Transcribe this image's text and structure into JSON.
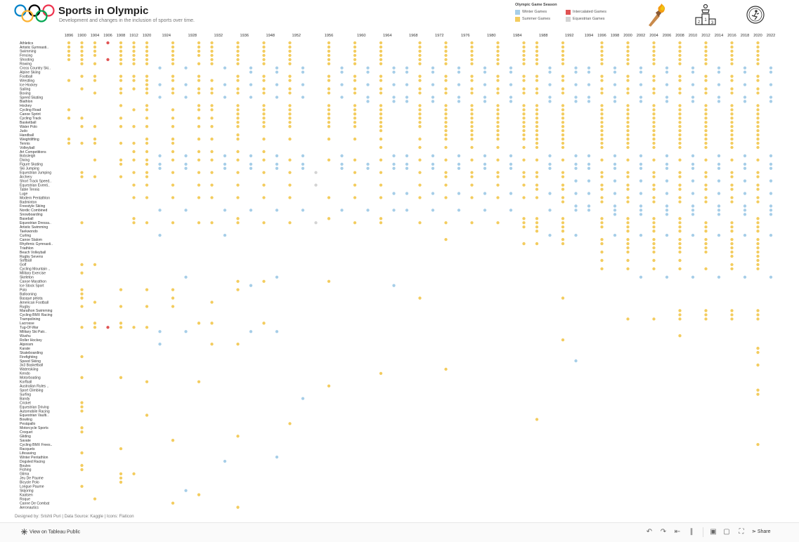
{
  "header": {
    "title": "Sports in Olympic",
    "subtitle": "Development and changes in the inclusion of sports over time."
  },
  "legend": {
    "title": "Olympic Game Season",
    "items": [
      {
        "label": "Winter Games",
        "color": "#a6cee8"
      },
      {
        "label": "Summer Games",
        "color": "#f3cc5e"
      },
      {
        "label": "Intercalated Games",
        "color": "#e05353"
      },
      {
        "label": "Equestrian Games",
        "color": "#d3d3d3"
      }
    ]
  },
  "icons": [
    "olympic-rings-icon",
    "olympic-torch-icon",
    "podium-icon",
    "medal-icon"
  ],
  "credits": "Designed by: Srishti Puri | Data Source: Kaggle | Icons: Flaticon",
  "footer": {
    "view_label": "View on Tableau Public",
    "share_label": "Share"
  },
  "chart_data": {
    "type": "scatter",
    "x_axis_position": "top",
    "columns": [
      {
        "year": "1896",
        "season": "Summer"
      },
      {
        "year": "1900",
        "season": "Summer"
      },
      {
        "year": "1904",
        "season": "Summer"
      },
      {
        "year": "1906",
        "season": "Intercalated"
      },
      {
        "year": "1908",
        "season": "Summer"
      },
      {
        "year": "1912",
        "season": "Summer"
      },
      {
        "year": "1920",
        "season": "Summer"
      },
      {
        "year": "1924",
        "season": "Winter"
      },
      {
        "year": "1924",
        "season": "Summer"
      },
      {
        "year": "1928",
        "season": "Winter"
      },
      {
        "year": "1928",
        "season": "Summer"
      },
      {
        "year": "1932",
        "season": "Summer"
      },
      {
        "year": "1932",
        "season": "Winter"
      },
      {
        "year": "1936",
        "season": "Summer"
      },
      {
        "year": "1936",
        "season": "Winter"
      },
      {
        "year": "1948",
        "season": "Summer"
      },
      {
        "year": "1948",
        "season": "Winter"
      },
      {
        "year": "1952",
        "season": "Summer"
      },
      {
        "year": "1952",
        "season": "Winter"
      },
      {
        "year": "1956",
        "season": "Equestrian"
      },
      {
        "year": "1956",
        "season": "Summer"
      },
      {
        "year": "1956",
        "season": "Winter"
      },
      {
        "year": "1960",
        "season": "Summer"
      },
      {
        "year": "1960",
        "season": "Winter"
      },
      {
        "year": "1964",
        "season": "Summer"
      },
      {
        "year": "1964",
        "season": "Winter"
      },
      {
        "year": "1968",
        "season": "Winter"
      },
      {
        "year": "1968",
        "season": "Summer"
      },
      {
        "year": "1972",
        "season": "Winter"
      },
      {
        "year": "1972",
        "season": "Summer"
      },
      {
        "year": "1976",
        "season": "Winter"
      },
      {
        "year": "1976",
        "season": "Summer"
      },
      {
        "year": "1980",
        "season": "Winter"
      },
      {
        "year": "1980",
        "season": "Summer"
      },
      {
        "year": "1984",
        "season": "Winter"
      },
      {
        "year": "1984",
        "season": "Summer"
      },
      {
        "year": "1988",
        "season": "Summer"
      },
      {
        "year": "1988",
        "season": "Winter"
      },
      {
        "year": "1992",
        "season": "Summer"
      },
      {
        "year": "1992",
        "season": "Winter"
      },
      {
        "year": "1994",
        "season": "Winter"
      },
      {
        "year": "1996",
        "season": "Summer"
      },
      {
        "year": "1998",
        "season": "Winter"
      },
      {
        "year": "2000",
        "season": "Summer"
      },
      {
        "year": "2002",
        "season": "Winter"
      },
      {
        "year": "2004",
        "season": "Summer"
      },
      {
        "year": "2006",
        "season": "Winter"
      },
      {
        "year": "2008",
        "season": "Summer"
      },
      {
        "year": "2010",
        "season": "Winter"
      },
      {
        "year": "2012",
        "season": "Summer"
      },
      {
        "year": "2014",
        "season": "Winter"
      },
      {
        "year": "2016",
        "season": "Summer"
      },
      {
        "year": "2018",
        "season": "Winter"
      },
      {
        "year": "2020",
        "season": "Summer"
      },
      {
        "year": "2022",
        "season": "Winter"
      }
    ],
    "sports": [
      {
        "name": "Athletics",
        "years": "1896 1900 1904 1906I 1908 1912 1920 1924 1928 1932 1936 1948 1952 1956 1960 1964 1968 1972 1976 1980 1984 1988 1992 1996 2000 2004 2008 2012 2016 2020"
      },
      {
        "name": "Artistic Gymnastics",
        "years": "1896 1900 1904 1908 1912 1920 1924 1928 1932 1936 1948 1952 1956 1960 1964 1968 1972 1976 1980 1984 1988 1992 1996 2000 2004 2008 2012 2016 2020"
      },
      {
        "name": "Swimming",
        "years": "1896 1900 1904 1908 1912 1920 1924 1928 1932 1936 1948 1952 1956 1960 1964 1968 1972 1976 1980 1984 1988 1992 1996 2000 2004 2008 2012 2016 2020"
      },
      {
        "name": "Fencing",
        "years": "1896 1900 1904 1908 1912 1920 1924 1928 1932 1936 1948 1952 1956 1960 1964 1968 1972 1976 1980 1984 1988 1992 1996 2000 2004 2008 2012 2016 2020"
      },
      {
        "name": "Shooting",
        "years": "1896 1900 1906I 1908 1912 1920 1924 1932 1936 1948 1952 1956 1960 1964 1968 1972 1976 1980 1984 1988 1992 1996 2000 2004 2008 2012 2016 2020"
      },
      {
        "name": "Rowing",
        "years": "1900 1904 1908 1912 1920 1924 1928 1932 1936 1948 1952 1956 1960 1964 1968 1972 1976 1980 1984 1988 1992 1996 2000 2004 2008 2012 2016 2020"
      },
      {
        "name": "Cross Country Skiing",
        "years": "1924W 1928W 1932W 1936W 1948W 1952W 1956W 1960W 1964W 1968W 1972W 1976W 1980W 1984W 1988W 1992W 1994W 1998W 2002W 2006W 2010W 2014W 2018W 2022W"
      },
      {
        "name": "Alpine Skiing",
        "years": "1936W 1948W 1952W 1956W 1960W 1964W 1968W 1972W 1976W 1980W 1984W 1988W 1992W 1994W 1998W 2002W 2006W 2010W 2014W 2018W 2022W"
      },
      {
        "name": "Football",
        "years": "1900 1904 1908 1912 1920 1924 1928 1936 1948 1952 1956 1960 1964 1968 1972 1976 1980 1984 1988 1992 1996 2000 2004 2008 2012 2016 2020"
      },
      {
        "name": "Wrestling",
        "years": "1896 1904 1908 1912 1920 1924 1928 1932 1936 1948 1952 1956 1960 1964 1968 1972 1976 1980 1984 1988 1992 1996 2000 2004 2008 2012 2016 2020"
      },
      {
        "name": "Ice Hockey",
        "years": "1920 1924W 1928W 1932W 1936W 1948W 1952W 1956W 1960W 1964W 1968W 1972W 1976W 1980W 1984W 1988W 1992W 1994W 1998W 2002W 2006W 2010W 2014W 2018W 2022W"
      },
      {
        "name": "Sailing",
        "years": "1900 1908 1912 1920 1924 1928 1932 1936 1948 1952 1956 1960 1964 1968 1972 1976 1980 1984 1988 1992 1996 2000 2004 2008 2012 2016 2020"
      },
      {
        "name": "Boxing",
        "years": "1904 1908 1920 1924 1928 1932 1936 1948 1952 1956 1960 1964 1968 1972 1976 1980 1984 1988 1992 1996 2000 2004 2008 2012 2016 2020"
      },
      {
        "name": "Speed Skating",
        "years": "1924W 1928W 1932W 1936W 1948W 1952W 1956W 1960W 1964W 1968W 1972W 1976W 1980W 1984W 1988W 1992W 1994W 1998W 2002W 2006W 2010W 2014W 2018W 2022W"
      },
      {
        "name": "Biathlon",
        "years": "1960W 1964W 1968W 1972W 1976W 1980W 1984W 1988W 1992W 1994W 1998W 2002W 2006W 2010W 2014W 2018W 2022W"
      },
      {
        "name": "Hockey",
        "years": "1908 1920 1928 1932 1936 1948 1952 1956 1960 1964 1968 1972 1976 1980 1984 1988 1992 1996 2000 2004 2008 2012 2016 2020"
      },
      {
        "name": "Cycling Road",
        "years": "1896 1912 1920 1924 1928 1932 1936 1948 1952 1956 1960 1964 1968 1972 1976 1980 1984 1988 1992 1996 2000 2004 2008 2012 2016 2020"
      },
      {
        "name": "Canoe Sprint",
        "years": "1936 1948 1952 1956 1960 1964 1968 1972 1976 1980 1984 1988 1992 1996 2000 2004 2008 2012 2016 2020"
      },
      {
        "name": "Cycling Track",
        "years": "1896 1900 1908 1920 1924 1928 1932 1936 1948 1952 1956 1960 1964 1968 1972 1976 1980 1984 1988 1992 1996 2000 2004 2008 2012 2016 2020"
      },
      {
        "name": "Basketball",
        "years": "1936 1948 1952 1956 1960 1964 1968 1972 1976 1980 1984 1988 1992 1996 2000 2004 2008 2012 2016 2020"
      },
      {
        "name": "Water Polo",
        "years": "1900 1904 1908 1912 1920 1924 1928 1932 1936 1948 1952 1956 1960 1964 1968 1972 1976 1980 1984 1988 1992 1996 2000 2004 2008 2012 2016 2020"
      },
      {
        "name": "Judo",
        "years": "1964 1972 1976 1980 1984 1988 1992 1996 2000 2004 2008 2012 2016 2020"
      },
      {
        "name": "Handball",
        "years": "1936 1972 1976 1980 1984 1988 1992 1996 2000 2004 2008 2012 2016 2020"
      },
      {
        "name": "Weightlifting",
        "years": "1896 1904 1920 1924 1928 1932 1936 1948 1952 1956 1960 1964 1968 1972 1976 1980 1984 1988 1992 1996 2000 2004 2008 2012 2016 2020"
      },
      {
        "name": "Tennis",
        "years": "1896 1900 1904 1908 1912 1920 1924 1988 1992 1996 2000 2004 2008 2012 2016 2020"
      },
      {
        "name": "Volleyball",
        "years": "1964 1968 1972 1976 1980 1984 1988 1992 1996 2000 2004 2008 2012 2016 2020"
      },
      {
        "name": "Art Competitions",
        "years": "1912 1920 1924 1928 1932 1936 1948"
      },
      {
        "name": "Bobsleigh",
        "years": "1924W 1928W 1932W 1936W 1948W 1952W 1956W 1964W 1968W 1972W 1976W 1980W 1984W 1988W 1992W 1994W 1998W 2002W 2006W 2010W 2014W 2018W 2022W"
      },
      {
        "name": "Diving",
        "years": "1904 1908 1912 1920 1924 1928 1932 1936 1948 1952 1956 1960 1964 1968 1972 1976 1980 1984 1988 1992 1996 2000 2004 2008 2012 2016 2020"
      },
      {
        "name": "Figure Skating",
        "years": "1908 1920 1924W 1928W 1932W 1936W 1948W 1952W 1956W 1960W 1964W 1968W 1972W 1976W 1980W 1984W 1988W 1992W 1994W 1998W 2002W 2006W 2010W 2014W 2018W 2022W"
      },
      {
        "name": "Ski Jumping",
        "years": "1924W 1928W 1932W 1936W 1948W 1952W 1956W 1960W 1964W 1968W 1972W 1976W 1980W 1984W 1988W 1992W 1994W 1998W 2002W 2006W 2010W 2014W 2018W 2022W"
      },
      {
        "name": "Equestrian Jumping",
        "years": "1900 1912 1920 1924 1928 1932 1936 1948 1952 1956E 1960 1964 1968 1972 1976 1980 1984 1988 1992 1996 2000 2004 2008 2012 2016 2020"
      },
      {
        "name": "Archery",
        "years": "1900 1904 1908 1920 1972 1976 1980 1984 1988 1992 1996 2000 2004 2008 2012 2016 2020"
      },
      {
        "name": "Short Track Speed Skating",
        "years": "1992W 1994W 1998W 2002W 2006W 2010W 2014W 2018W 2022W"
      },
      {
        "name": "Equestrian Eventing",
        "years": "1912 1920 1924 1928 1932 1936 1948 1952 1956E 1960 1964 1968 1972 1976 1980 1984 1988 1992 1996 2000 2004 2008 2012 2016 2020"
      },
      {
        "name": "Table Tennis",
        "years": "1988 1992 1996 2000 2004 2008 2012 2016 2020"
      },
      {
        "name": "Luge",
        "years": "1964W 1968W 1972W 1976W 1980W 1984W 1988W 1992W 1994W 1998W 2002W 2006W 2010W 2014W 2018W 2022W"
      },
      {
        "name": "Modern Pentathlon",
        "years": "1912 1920 1924 1928 1932 1936 1948 1952 1956 1960 1964 1968 1972 1976 1980 1984 1988 1992 1996 2000 2004 2008 2012 2016 2020"
      },
      {
        "name": "Badminton",
        "years": "1992 1996 2000 2004 2008 2012 2016 2020"
      },
      {
        "name": "Freestyle Skiing",
        "years": "1992W 1994W 1998W 2002W 2006W 2010W 2014W 2018W 2022W"
      },
      {
        "name": "Nordic Combined",
        "years": "1924W 1928W 1932W 1936W 1948W 1952W 1956W 1960W 1964W 1968W 1972W 1976W 1980W 1984W 1988W 1992W 1994W 1998W 2002W 2006W 2010W 2014W 2018W 2022W"
      },
      {
        "name": "Snowboarding",
        "years": "1998W 2002W 2006W 2010W 2014W 2018W 2022W"
      },
      {
        "name": "Baseball",
        "years": "1912 1936 1956 1964 1984 1988 1992 1996 2000 2004 2008 2020"
      },
      {
        "name": "Equestrian Dressage",
        "years": "1900 1912 1920 1924 1928 1932 1936 1948 1952 1956E 1960 1964 1968 1972 1976 1980 1984 1988 1992 1996 2000 2004 2008 2012 2016 2020"
      },
      {
        "name": "Artistic Swimming",
        "years": "1984 1988 1992 1996 2000 2004 2008 2012 2016 2020"
      },
      {
        "name": "Taekwondo",
        "years": "1988 1992 2000 2004 2008 2012 2016 2020"
      },
      {
        "name": "Curling",
        "years": "1924W 1932W 1988W 1992W 1998W 2002W 2006W 2010W 2014W 2018W 2022W"
      },
      {
        "name": "Canoe Slalom",
        "years": "1972 1992 1996 2000 2004 2008 2012 2016 2020"
      },
      {
        "name": "Rhythmic Gymnastics",
        "years": "1984 1988 1992 1996 2000 2004 2008 2012 2016 2020"
      },
      {
        "name": "Triathlon",
        "years": "2000 2004 2008 2012 2016 2020"
      },
      {
        "name": "Beach Volleyball",
        "years": "1996 2000 2004 2008 2012 2016 2020"
      },
      {
        "name": "Rugby Sevens",
        "years": "2016 2020"
      },
      {
        "name": "Softball",
        "years": "1996 2000 2004 2008 2020"
      },
      {
        "name": "Golf",
        "years": "1900 1904 2016 2020"
      },
      {
        "name": "Cycling Mountain Bike",
        "years": "1996 2000 2004 2008 2012 2016 2020"
      },
      {
        "name": "Military Exercise",
        "years": "1900"
      },
      {
        "name": "Skeleton",
        "years": "1928W 1948W 2002W 2006W 2010W 2014W 2018W 2022W"
      },
      {
        "name": "Canoe Marathon",
        "years": "1936 1948 1956"
      },
      {
        "name": "Ice Stock Sport",
        "years": "1936W 1964W"
      },
      {
        "name": "Polo",
        "years": "1900 1908 1920 1924 1936"
      },
      {
        "name": "Ballooning",
        "years": "1900"
      },
      {
        "name": "Basque pelota",
        "years": "1900 1924 1968 1992"
      },
      {
        "name": "American Football",
        "years": "1904 1932"
      },
      {
        "name": "Rugby",
        "years": "1900 1908 1920 1924"
      },
      {
        "name": "Marathon Swimming",
        "years": "2008 2012 2016 2020"
      },
      {
        "name": "Cycling BMX Racing",
        "years": "2008 2012 2016 2020"
      },
      {
        "name": "Trampolining",
        "years": "2000 2004 2008 2012 2016 2020"
      },
      {
        "name": "Lacrosse",
        "years": "1904 1908 1928 1932 1948"
      },
      {
        "name": "Tug-Of-War",
        "years": "1900 1904 1906I 1908 1912 1920"
      },
      {
        "name": "Military Ski Patrol",
        "years": "1924W 1928W 1936W 1948W"
      },
      {
        "name": "Wushu",
        "years": "2008"
      },
      {
        "name": "Roller Hockey",
        "years": "1992"
      },
      {
        "name": "Alpinism",
        "years": "1924W 1932 1936"
      },
      {
        "name": "Karate",
        "years": "2020"
      },
      {
        "name": "Skateboarding",
        "years": "2020"
      },
      {
        "name": "Firefighting",
        "years": "1900"
      },
      {
        "name": "Speed Skiing",
        "years": "1992W"
      },
      {
        "name": "3x3 Basketball",
        "years": "2020"
      },
      {
        "name": "Waterskiing",
        "years": "1972"
      },
      {
        "name": "Kendo",
        "years": "1964"
      },
      {
        "name": "Motorboating",
        "years": "1900 1908"
      },
      {
        "name": "Korfball",
        "years": "1920 1928"
      },
      {
        "name": "Australian Rules Football",
        "years": "1956"
      },
      {
        "name": "Sport Climbing",
        "years": "2020"
      },
      {
        "name": "Surfing",
        "years": "2020"
      },
      {
        "name": "Bandy",
        "years": "1952W"
      },
      {
        "name": "Cricket",
        "years": "1900"
      },
      {
        "name": "Equestrian Driving",
        "years": "1900"
      },
      {
        "name": "Automobile Racing",
        "years": "1900"
      },
      {
        "name": "Equestrian Vaulting",
        "years": "1920"
      },
      {
        "name": "Bowling",
        "years": "1988"
      },
      {
        "name": "Pesäpallo",
        "years": "1952"
      },
      {
        "name": "Motorcycle Sports",
        "years": "1900"
      },
      {
        "name": "Croquet",
        "years": "1900"
      },
      {
        "name": "Gliding",
        "years": "1936"
      },
      {
        "name": "Savate",
        "years": "1924"
      },
      {
        "name": "Cycling BMX Freestyle",
        "years": "2020"
      },
      {
        "name": "Racquets",
        "years": "1908"
      },
      {
        "name": "Lifesaving",
        "years": "1900"
      },
      {
        "name": "Winter Pentathlon",
        "years": "1948W"
      },
      {
        "name": "Dogsled Racing",
        "years": "1932W"
      },
      {
        "name": "Boules",
        "years": "1900"
      },
      {
        "name": "Fishing",
        "years": "1900"
      },
      {
        "name": "Glima",
        "years": "1908 1912"
      },
      {
        "name": "Jeu De Paume",
        "years": "1908"
      },
      {
        "name": "Bicycle Polo",
        "years": "1908"
      },
      {
        "name": "Longue Paume",
        "years": "1900"
      },
      {
        "name": "Skijoring",
        "years": "1928W"
      },
      {
        "name": "Kaatsen",
        "years": "1928"
      },
      {
        "name": "Roque",
        "years": "1904"
      },
      {
        "name": "Canne De Combat",
        "years": "1924"
      },
      {
        "name": "Aeronautics",
        "years": "1936"
      }
    ]
  }
}
